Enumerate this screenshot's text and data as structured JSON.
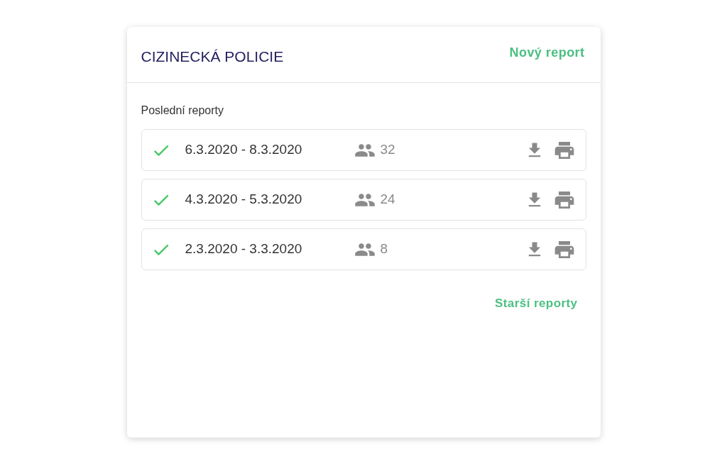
{
  "card": {
    "title": "CIZINECKÁ POLICIE",
    "new_report_link": "Nový report"
  },
  "section_title": "Poslední reporty",
  "reports": [
    {
      "period": "6.3.2020 - 8.3.2020",
      "people_count": "32",
      "done": true
    },
    {
      "period": "4.3.2020 - 5.3.2020",
      "people_count": "24",
      "done": true
    },
    {
      "period": "2.3.2020 - 3.3.2020",
      "people_count": "8",
      "done": true
    }
  ],
  "older_reports_link": "Starší reporty"
}
